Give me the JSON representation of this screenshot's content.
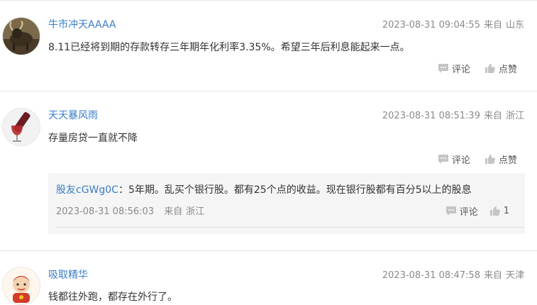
{
  "comments": [
    {
      "user": "牛市冲天AAAA",
      "time": "2023-08-31 09:04:55",
      "from_label": "来自",
      "location": "山东",
      "text": "8.11已经将到期的存款转存三年期年化利率3.35%。希望三年后利息能起来一点。",
      "comment_label": "评论",
      "like_label": "点赞"
    },
    {
      "user": "天天暴风雨",
      "time": "2023-08-31 08:51:39",
      "from_label": "来自",
      "location": "浙江",
      "text": "存量房贷一直就不降",
      "comment_label": "评论",
      "like_label": "点赞",
      "reply": {
        "user": "股友cGWg0C",
        "separator": "：",
        "text": "5年期。乱买个银行股。都有25个点的收益。现在银行股都有百分5以上的股息",
        "time": "2023-08-31 08:56:03",
        "from_label": "来自",
        "location": "浙江",
        "comment_label": "评论",
        "like_count": "1"
      }
    },
    {
      "user": "吸取精华",
      "time": "2023-08-31 08:47:58",
      "from_label": "来自",
      "location": "天津",
      "text": "钱都往外跑，都存在外行了。"
    }
  ],
  "icons": {
    "comment": "comment-bubble-icon",
    "like": "thumbs-up-icon"
  },
  "colors": {
    "username": "#3a7ec6",
    "meta": "#8a8a8a",
    "icon": "#c4c4c4"
  }
}
